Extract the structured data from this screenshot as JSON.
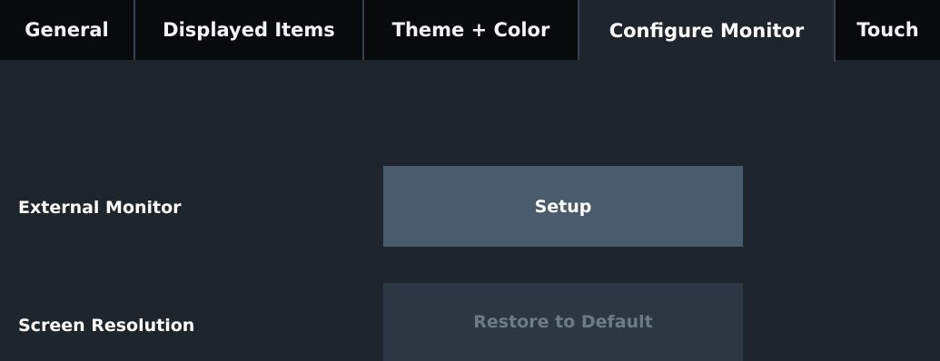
{
  "tabs": [
    {
      "label": "General",
      "active": false
    },
    {
      "label": "Displayed Items",
      "active": false
    },
    {
      "label": "Theme + Color",
      "active": false
    },
    {
      "label": "Configure Monitor",
      "active": true
    },
    {
      "label": "Touch",
      "active": false
    }
  ],
  "rows": {
    "external_monitor": {
      "label": "External Monitor",
      "button": "Setup"
    },
    "screen_resolution": {
      "label": "Screen Resolution",
      "button": "Restore to Default",
      "button_disabled": true
    }
  },
  "colors": {
    "background": "#1f252d",
    "tab_inactive": "#080a0c",
    "button_active": "#4a5b6c",
    "button_disabled": "#2c3743",
    "text_disabled": "#6e7a86"
  }
}
